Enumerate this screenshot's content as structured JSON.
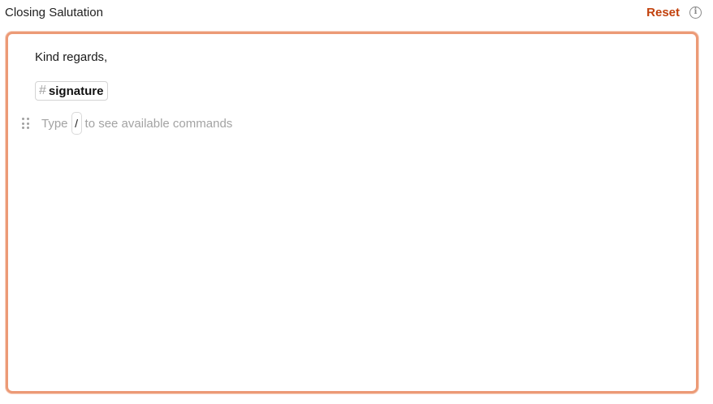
{
  "header": {
    "label": "Closing Salutation",
    "reset_label": "Reset",
    "info_icon": "info-circle-icon"
  },
  "editor": {
    "greeting_line": "Kind regards,",
    "variable": {
      "prefix": "#",
      "name": "signature"
    },
    "placeholder": {
      "before": "Type",
      "key": "/",
      "after": "to see available commands"
    },
    "drag_handle_icon": "drag-handle-icon"
  },
  "colors": {
    "accent": "#c2410c",
    "focus_border": "#ec9a76"
  }
}
